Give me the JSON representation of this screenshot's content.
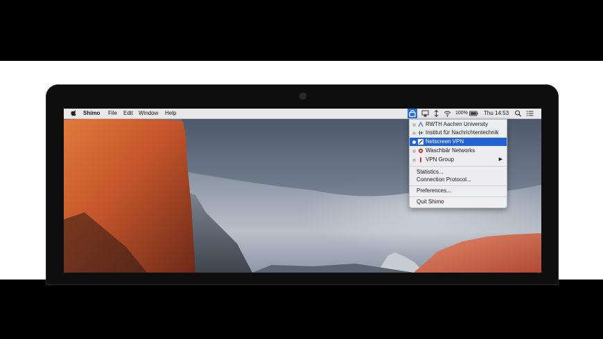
{
  "menubar": {
    "app_name": "Shimo",
    "menus": [
      "File",
      "Edit",
      "Window",
      "Help"
    ],
    "battery": "100%",
    "clock": "Thu 14:53",
    "status_icons": [
      "shimo-icon",
      "airplay-icon",
      "transfer-icon",
      "wifi-icon",
      "battery-icon",
      "spotlight-icon",
      "notification-center-icon"
    ]
  },
  "dropdown": {
    "vpn_items": [
      {
        "label": "RWTH Aachen University",
        "icon": "rwth-logo-icon",
        "selected": false
      },
      {
        "label": "Institut für Nachrichtentechnik",
        "icon": "ient-logo-icon",
        "selected": false
      },
      {
        "label": "Netscreen VPN",
        "icon": "netscreen-logo-icon",
        "selected": true
      },
      {
        "label": "Waschbär Networks",
        "icon": "waschbaer-logo-icon",
        "selected": false
      },
      {
        "label": "VPN Group",
        "icon": "vpn-group-icon",
        "selected": false,
        "submenu": "▶"
      }
    ],
    "stats_items": [
      "Statistics...",
      "Connection Protocol..."
    ],
    "prefs": "Preferences...",
    "quit": "Quit Shimo"
  },
  "colors": {
    "selection": "#2463d6",
    "cliff_orange": "#d2652e",
    "sky": "#8d97a6"
  }
}
